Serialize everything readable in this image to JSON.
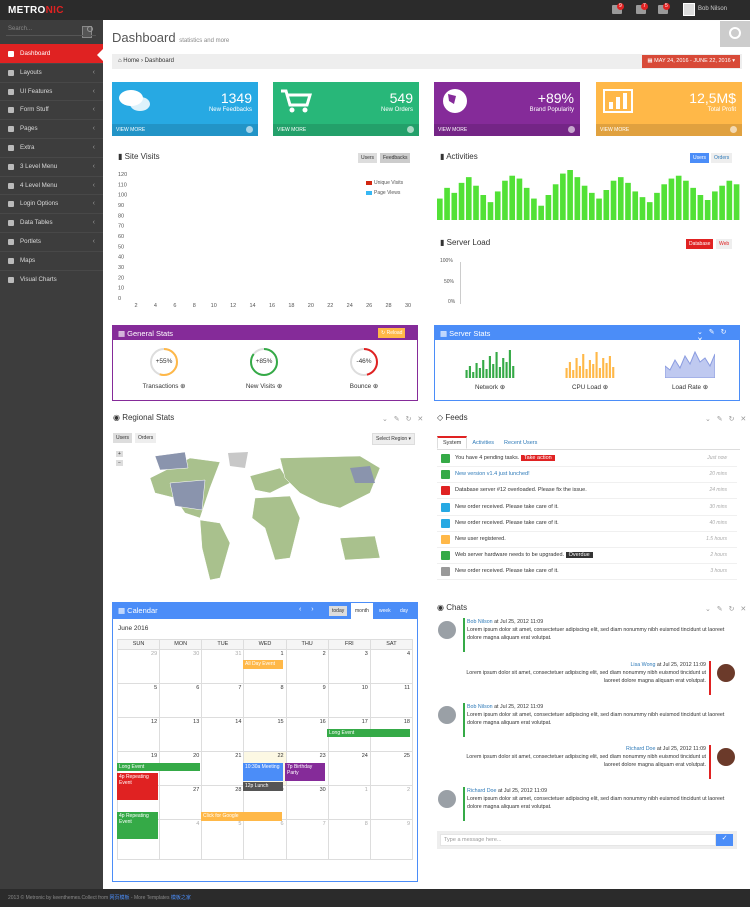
{
  "brand": {
    "part1": "METRO",
    "part2": "NIC"
  },
  "header": {
    "badge_notifications": "9",
    "badge_inbox": "7",
    "badge_tasks": "5",
    "user": "Bob Nilson"
  },
  "sidebar": {
    "search_placeholder": "Search...",
    "items": [
      {
        "label": "Dashboard"
      },
      {
        "label": "Layouts"
      },
      {
        "label": "UI Features"
      },
      {
        "label": "Form Stuff"
      },
      {
        "label": "Pages"
      },
      {
        "label": "Extra"
      },
      {
        "label": "3 Level Menu"
      },
      {
        "label": "4 Level Menu"
      },
      {
        "label": "Login Options"
      },
      {
        "label": "Data Tables"
      },
      {
        "label": "Portlets"
      },
      {
        "label": "Maps"
      },
      {
        "label": "Visual Charts"
      }
    ]
  },
  "page": {
    "title": "Dashboard",
    "subtitle": "statistics and more",
    "breadcrumb_home": "Home",
    "breadcrumb_current": "Dashboard",
    "date_range": "MAY 24, 2016 - JUNE 22, 2016"
  },
  "stats": [
    {
      "value": "1349",
      "label": "New Feedbacks",
      "more": "VIEW MORE",
      "color": "#27a9e3"
    },
    {
      "value": "549",
      "label": "New Orders",
      "more": "VIEW MORE",
      "color": "#28b779"
    },
    {
      "value": "+89%",
      "label": "Brand Popularity",
      "more": "VIEW MORE",
      "color": "#852b99"
    },
    {
      "value": "12,5M$",
      "label": "Total Profit",
      "more": "VIEW MORE",
      "color": "#ffb848"
    }
  ],
  "site_visits": {
    "title": "Site Visits",
    "btn_users": "Users",
    "btn_feedbacks": "Feedbacks",
    "legend": [
      "Unique Visits",
      "Page Views"
    ],
    "legend_colors": [
      "#d12610",
      "#37b7f3"
    ]
  },
  "activities": {
    "title": "Activities",
    "btn_users": "Users",
    "btn_orders": "Orders"
  },
  "server_load": {
    "title": "Server Load",
    "btn_database": "Database",
    "btn_web": "Web",
    "y_ticks": [
      "100%",
      "50%",
      "0%"
    ]
  },
  "general_stats": {
    "title": "General Stats",
    "reload": "Reload",
    "items": [
      {
        "value": "+55%",
        "label": "Transactions",
        "color": "#ffb848",
        "pct": 0.55
      },
      {
        "value": "+85%",
        "label": "New Visits",
        "color": "#35aa47",
        "pct": 0.85
      },
      {
        "value": "-46%",
        "label": "Bounce",
        "color": "#e02222",
        "pct": 0.46
      }
    ]
  },
  "server_stats": {
    "title": "Server Stats",
    "items": [
      {
        "label": "Network"
      },
      {
        "label": "CPU Load"
      },
      {
        "label": "Load Rate"
      }
    ]
  },
  "regional": {
    "title": "Regional Stats",
    "btn_users": "Users",
    "btn_orders": "Orders",
    "select_region": "Select Region"
  },
  "feeds": {
    "title": "Feeds",
    "tabs": [
      "System",
      "Activities",
      "Recent Users"
    ],
    "items": [
      {
        "text": "You have 4 pending tasks.",
        "tag": "Take action",
        "tag_color": "#e02222",
        "when": "Just now",
        "color": "#35aa47"
      },
      {
        "text": "New version v1.4 just lunched!",
        "when": "20 mins",
        "color": "#35aa47",
        "link": true
      },
      {
        "text": "Database server #12 overloaded. Please fix the issue.",
        "when": "24 mins",
        "color": "#e02222"
      },
      {
        "text": "New order received. Please take care of it.",
        "when": "30 mins",
        "color": "#27a9e3"
      },
      {
        "text": "New order received. Please take care of it.",
        "when": "40 mins",
        "color": "#27a9e3"
      },
      {
        "text": "New user registered.",
        "when": "1.5 hours",
        "color": "#ffb848"
      },
      {
        "text": "Web server hardware needs to be upgraded.",
        "tag": "Overdue",
        "tag_color": "#333",
        "when": "2 hours",
        "color": "#35aa47"
      },
      {
        "text": "New order received. Please take care of it.",
        "when": "3 hours",
        "color": "#999"
      }
    ]
  },
  "calendar": {
    "title": "Calendar",
    "month_label": "June 2016",
    "today": "today",
    "views": [
      "month",
      "week",
      "day"
    ],
    "days": [
      "SUN",
      "MON",
      "TUE",
      "WED",
      "THU",
      "FRI",
      "SAT"
    ],
    "weeks": [
      [
        "29",
        "30",
        "31",
        "1",
        "2",
        "3",
        "4"
      ],
      [
        "5",
        "6",
        "7",
        "8",
        "9",
        "10",
        "11"
      ],
      [
        "12",
        "13",
        "14",
        "15",
        "16",
        "17",
        "18"
      ],
      [
        "19",
        "20",
        "21",
        "22",
        "23",
        "24",
        "25"
      ],
      [
        "26",
        "27",
        "28",
        "29",
        "30",
        "1",
        "2"
      ],
      [
        "3",
        "4",
        "5",
        "6",
        "7",
        "8",
        "9"
      ]
    ],
    "events": {
      "all_day": "All Day Event",
      "long1": "Long Event",
      "long2": "Long Event",
      "repeat1": "4p Repeating Event",
      "meeting": "10:30a Meeting",
      "lunch": "12p Lunch",
      "birthday": "7p Birthday Party",
      "repeat2": "4p Repeating Event",
      "google": "Click for Google"
    }
  },
  "chats": {
    "title": "Chats",
    "input_placeholder": "Type a message here...",
    "messages": [
      {
        "name": "Bob Nilson",
        "time": "at Jul 25, 2012 11:09",
        "body": "Lorem ipsum dolor sit amet, consectetuer adipiscing elit, sed diam nonummy nibh euismod tincidunt ut laoreet dolore magna aliquam erat volutpat."
      },
      {
        "name": "Lisa Wong",
        "time": "at Jul 25, 2012 11:09",
        "body": "Lorem ipsum dolor sit amet, consectetuer adipiscing elit, sed diam nonummy nibh euismod tincidunt ut laoreet dolore magna aliquam erat volutpat."
      },
      {
        "name": "Bob Nilson",
        "time": "at Jul 25, 2012 11:09",
        "body": "Lorem ipsum dolor sit amet, consectetuer adipiscing elit, sed diam nonummy nibh euismod tincidunt ut laoreet dolore magna aliquam erat volutpat."
      },
      {
        "name": "Richard Doe",
        "time": "at Jul 25, 2012 11:09",
        "body": "Lorem ipsum dolor sit amet, consectetuer adipiscing elit, sed diam nonummy nibh euismod tincidunt ut laoreet dolore magna aliquam erat volutpat."
      },
      {
        "name": "Richard Doe",
        "time": "at Jul 25, 2012 11:09",
        "body": "Lorem ipsum dolor sit amet, consectetuer adipiscing elit, sed diam nonummy nibh euismod tincidunt ut laoreet dolore magna aliquam erat volutpat."
      }
    ]
  },
  "footer": {
    "text": "2013 © Metronic by keenthemes.Collect from",
    "link1": "网页模板",
    "text2": " - More Templates ",
    "link2": "模板之家"
  },
  "chart_data": [
    {
      "type": "line",
      "title": "Site Visits",
      "x": [
        2,
        4,
        6,
        8,
        10,
        12,
        14,
        16,
        18,
        20,
        22,
        24,
        26,
        28,
        30
      ],
      "ylim": [
        0,
        120
      ],
      "y_ticks": [
        0,
        10,
        20,
        30,
        40,
        50,
        60,
        70,
        80,
        90,
        100,
        110,
        120
      ],
      "series": [
        {
          "name": "Unique Visits",
          "values": []
        },
        {
          "name": "Page Views",
          "values": []
        }
      ],
      "legend": "top-right"
    },
    {
      "type": "bar",
      "title": "Activities",
      "values": [
        30,
        45,
        38,
        52,
        60,
        48,
        35,
        25,
        40,
        55,
        62,
        58,
        45,
        30,
        20,
        35,
        50,
        65,
        70,
        60,
        48,
        38,
        30,
        42,
        55,
        60,
        52,
        40,
        32,
        25,
        38,
        50,
        58,
        62,
        55,
        45,
        35,
        28,
        40,
        48,
        55,
        50
      ]
    }
  ]
}
